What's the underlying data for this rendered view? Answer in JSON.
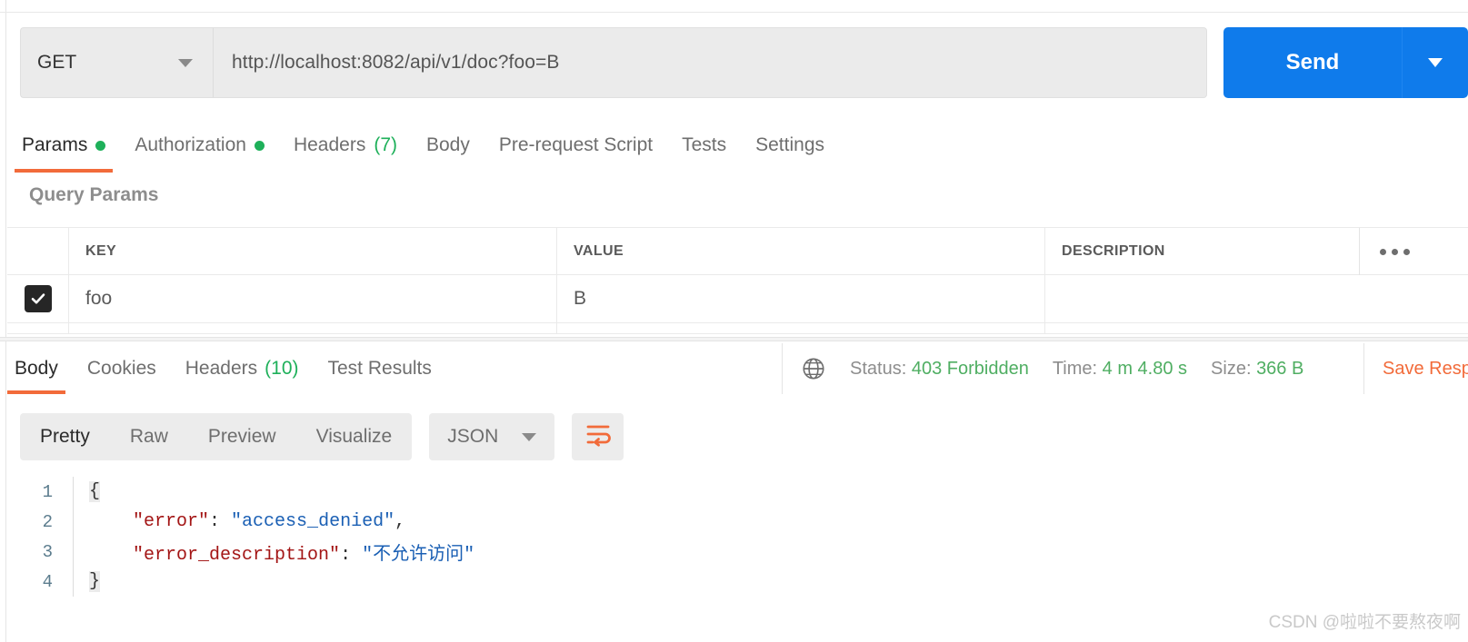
{
  "request": {
    "method": "GET",
    "url": "http://localhost:8082/api/v1/doc?foo=B",
    "send_label": "Send",
    "tabs": [
      {
        "label": "Params",
        "badge_dot": true,
        "count": ""
      },
      {
        "label": "Authorization",
        "badge_dot": true,
        "count": ""
      },
      {
        "label": "Headers",
        "badge_dot": false,
        "count": "(7)"
      },
      {
        "label": "Body",
        "badge_dot": false,
        "count": ""
      },
      {
        "label": "Pre-request Script",
        "badge_dot": false,
        "count": ""
      },
      {
        "label": "Tests",
        "badge_dot": false,
        "count": ""
      },
      {
        "label": "Settings",
        "badge_dot": false,
        "count": ""
      }
    ]
  },
  "query_params": {
    "section_title": "Query Params",
    "columns": {
      "key": "KEY",
      "value": "VALUE",
      "description": "DESCRIPTION"
    },
    "rows": [
      {
        "checked": true,
        "key": "foo",
        "value": "B",
        "description": ""
      }
    ]
  },
  "response": {
    "tabs": [
      {
        "label": "Body",
        "count": ""
      },
      {
        "label": "Cookies",
        "count": ""
      },
      {
        "label": "Headers",
        "count": "(10)"
      },
      {
        "label": "Test Results",
        "count": ""
      }
    ],
    "status_label": "Status:",
    "status_value": "403 Forbidden",
    "time_label": "Time:",
    "time_value": "4 m 4.80 s",
    "size_label": "Size:",
    "size_value": "366 B",
    "save_label": "Save Response",
    "view_modes": [
      "Pretty",
      "Raw",
      "Preview",
      "Visualize"
    ],
    "active_view": "Pretty",
    "format": "JSON",
    "body_lines": [
      {
        "num": "1",
        "indent": 0,
        "parts": [
          {
            "t": "{",
            "c": "brace"
          }
        ]
      },
      {
        "num": "2",
        "indent": 4,
        "parts": [
          {
            "t": "\"error\"",
            "c": "key"
          },
          {
            "t": ": ",
            "c": "punct"
          },
          {
            "t": "\"access_denied\"",
            "c": "str"
          },
          {
            "t": ",",
            "c": "punct"
          }
        ]
      },
      {
        "num": "3",
        "indent": 4,
        "parts": [
          {
            "t": "\"error_description\"",
            "c": "key"
          },
          {
            "t": ": ",
            "c": "punct"
          },
          {
            "t": "\"不允许访问\"",
            "c": "str"
          }
        ]
      },
      {
        "num": "4",
        "indent": 0,
        "parts": [
          {
            "t": "}",
            "c": "brace"
          }
        ]
      }
    ]
  },
  "colors": {
    "accent_orange": "#f26b3a",
    "send_blue": "#0f7beb",
    "status_green": "#4fae62",
    "dot_green": "#1eb05a"
  },
  "watermark": "CSDN @啦啦不要熬夜啊"
}
